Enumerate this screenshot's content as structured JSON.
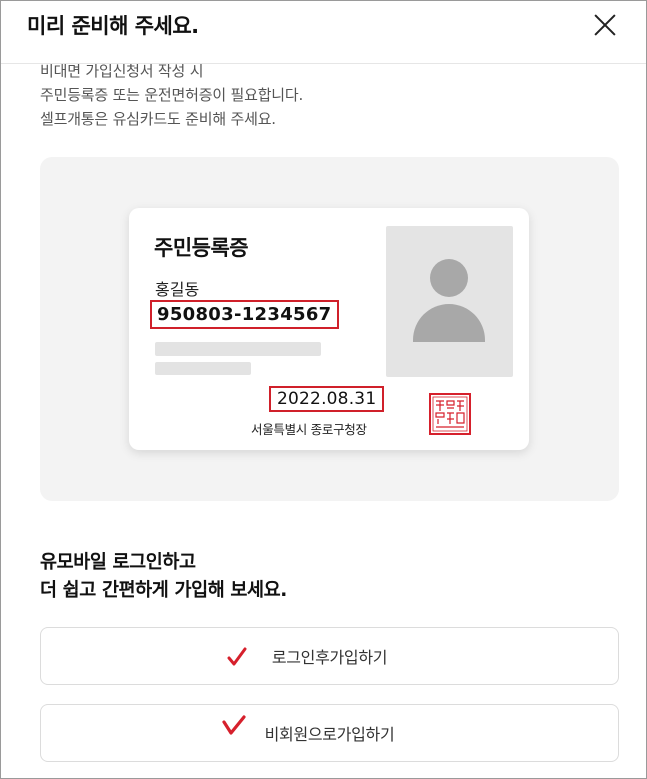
{
  "modal": {
    "title": "미리 준비해 주세요."
  },
  "intro": {
    "lines": [
      "비대면 가입신청서 작성 시",
      "주민등록증 또는 운전면허증이 필요합니다.",
      "셀프개통은 유심카드도 준비해 주세요."
    ]
  },
  "id_card": {
    "title": "주민등록증",
    "name": "홍길동",
    "resident_number": "950803-1234567",
    "issue_date": "2022.08.31",
    "issuer": "서울특별시 종로구청장",
    "seal_text": "서울특별시종로구청장인"
  },
  "prompt": {
    "lines": [
      "유모바일 로그인하고",
      "더 쉽고 간편하게 가입해 보세요."
    ]
  },
  "actions": {
    "login_join": "로그인후가입하기",
    "guest_join": "비회원으로가입하기"
  },
  "colors": {
    "highlight": "#d0202a",
    "card_area_bg": "#f3f3f3",
    "check_mark": "#d6202c"
  }
}
